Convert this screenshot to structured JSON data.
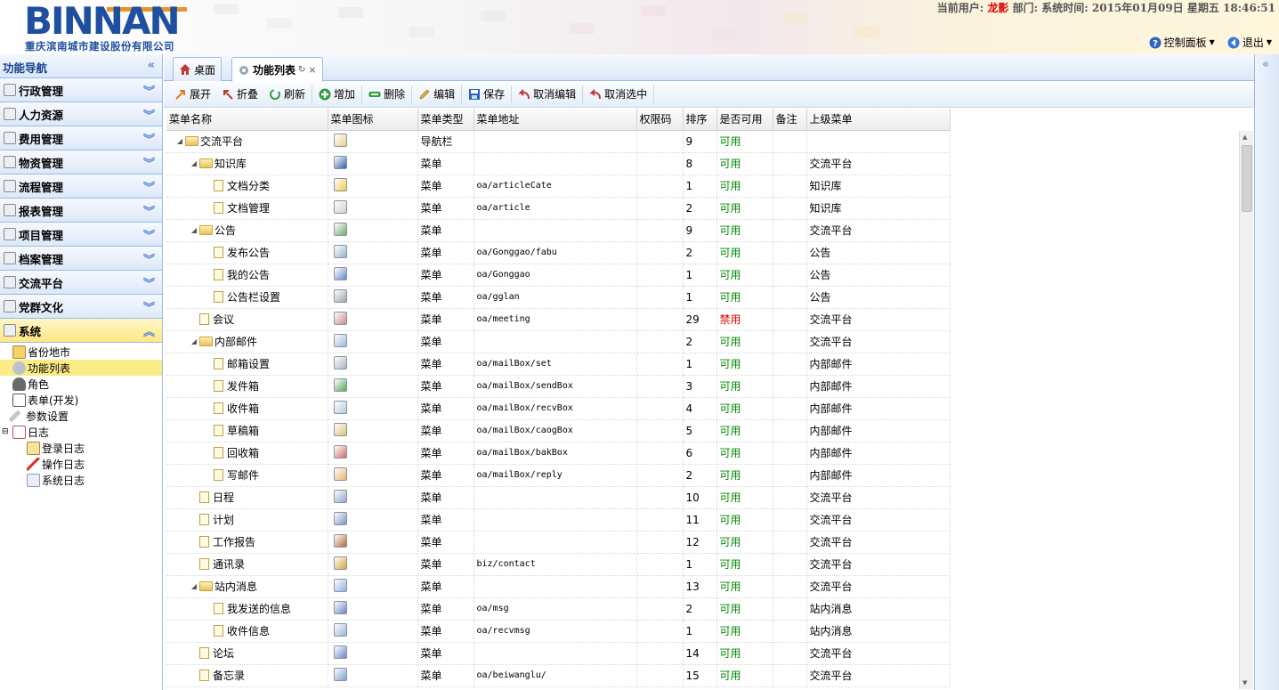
{
  "header": {
    "logo": "BINNAN",
    "company": "重庆滨南城市建设股份有限公司",
    "user_label": "当前用户:",
    "user_name": "龙影",
    "dept_label": "部门:",
    "time_label": "系统时间:",
    "time_value": "2015年01月09日 星期五 18:46:51",
    "control_panel": "控制面板",
    "logout": "退出"
  },
  "nav": {
    "title": "功能导航",
    "sections": [
      {
        "label": "行政管理"
      },
      {
        "label": "人力资源"
      },
      {
        "label": "费用管理"
      },
      {
        "label": "物资管理"
      },
      {
        "label": "流程管理"
      },
      {
        "label": "报表管理"
      },
      {
        "label": "项目管理"
      },
      {
        "label": "档案管理"
      },
      {
        "label": "交流平台"
      },
      {
        "label": "党群文化"
      },
      {
        "label": "系统"
      }
    ],
    "tree": [
      {
        "label": "省份地市"
      },
      {
        "label": "功能列表"
      },
      {
        "label": "角色"
      },
      {
        "label": "表单(开发)"
      },
      {
        "label": "参数设置"
      },
      {
        "label": "日志"
      },
      {
        "label": "登录日志"
      },
      {
        "label": "操作日志"
      },
      {
        "label": "系统日志"
      }
    ]
  },
  "tabs": [
    {
      "label": "桌面"
    },
    {
      "label": "功能列表"
    }
  ],
  "toolbar": {
    "expand": "展开",
    "collapse": "折叠",
    "refresh": "刷新",
    "add": "增加",
    "delete": "删除",
    "edit": "编辑",
    "save": "保存",
    "cancel_edit": "取消编辑",
    "cancel_select": "取消选中"
  },
  "columns": [
    "菜单名称",
    "菜单图标",
    "菜单类型",
    "菜单地址",
    "权限码",
    "排序",
    "是否可用",
    "备注",
    "上级菜单"
  ],
  "rows": [
    {
      "name": "交流平台",
      "type": "导航栏",
      "url": "",
      "code": "",
      "order": "9",
      "status": "可用",
      "note": "",
      "parent": ""
    },
    {
      "name": "知识库",
      "type": "菜单",
      "url": "",
      "code": "",
      "order": "8",
      "status": "可用",
      "note": "",
      "parent": "交流平台"
    },
    {
      "name": "文档分类",
      "type": "菜单",
      "url": "oa/articleCate",
      "code": "",
      "order": "1",
      "status": "可用",
      "note": "",
      "parent": "知识库"
    },
    {
      "name": "文档管理",
      "type": "菜单",
      "url": "oa/article",
      "code": "",
      "order": "2",
      "status": "可用",
      "note": "",
      "parent": "知识库"
    },
    {
      "name": "公告",
      "type": "菜单",
      "url": "",
      "code": "",
      "order": "9",
      "status": "可用",
      "note": "",
      "parent": "交流平台"
    },
    {
      "name": "发布公告",
      "type": "菜单",
      "url": "oa/Gonggao/fabu",
      "code": "",
      "order": "2",
      "status": "可用",
      "note": "",
      "parent": "公告"
    },
    {
      "name": "我的公告",
      "type": "菜单",
      "url": "oa/Gonggao",
      "code": "",
      "order": "1",
      "status": "可用",
      "note": "",
      "parent": "公告"
    },
    {
      "name": "公告栏设置",
      "type": "菜单",
      "url": "oa/gglan",
      "code": "",
      "order": "1",
      "status": "可用",
      "note": "",
      "parent": "公告"
    },
    {
      "name": "会议",
      "type": "菜单",
      "url": "oa/meeting",
      "code": "",
      "order": "29",
      "status": "禁用",
      "note": "",
      "parent": "交流平台"
    },
    {
      "name": "内部邮件",
      "type": "菜单",
      "url": "",
      "code": "",
      "order": "2",
      "status": "可用",
      "note": "",
      "parent": "交流平台"
    },
    {
      "name": "邮箱设置",
      "type": "菜单",
      "url": "oa/mailBox/set",
      "code": "",
      "order": "1",
      "status": "可用",
      "note": "",
      "parent": "内部邮件"
    },
    {
      "name": "发件箱",
      "type": "菜单",
      "url": "oa/mailBox/sendBox",
      "code": "",
      "order": "3",
      "status": "可用",
      "note": "",
      "parent": "内部邮件"
    },
    {
      "name": "收件箱",
      "type": "菜单",
      "url": "oa/mailBox/recvBox",
      "code": "",
      "order": "4",
      "status": "可用",
      "note": "",
      "parent": "内部邮件"
    },
    {
      "name": "草稿箱",
      "type": "菜单",
      "url": "oa/mailBox/caogBox",
      "code": "",
      "order": "5",
      "status": "可用",
      "note": "",
      "parent": "内部邮件"
    },
    {
      "name": "回收箱",
      "type": "菜单",
      "url": "oa/mailBox/bakBox",
      "code": "",
      "order": "6",
      "status": "可用",
      "note": "",
      "parent": "内部邮件"
    },
    {
      "name": "写邮件",
      "type": "菜单",
      "url": "oa/mailBox/reply",
      "code": "",
      "order": "2",
      "status": "可用",
      "note": "",
      "parent": "内部邮件"
    },
    {
      "name": "日程",
      "type": "菜单",
      "url": "",
      "code": "",
      "order": "10",
      "status": "可用",
      "note": "",
      "parent": "交流平台"
    },
    {
      "name": "计划",
      "type": "菜单",
      "url": "",
      "code": "",
      "order": "11",
      "status": "可用",
      "note": "",
      "parent": "交流平台"
    },
    {
      "name": "工作报告",
      "type": "菜单",
      "url": "",
      "code": "",
      "order": "12",
      "status": "可用",
      "note": "",
      "parent": "交流平台"
    },
    {
      "name": "通讯录",
      "type": "菜单",
      "url": "biz/contact",
      "code": "",
      "order": "1",
      "status": "可用",
      "note": "",
      "parent": "交流平台"
    },
    {
      "name": "站内消息",
      "type": "菜单",
      "url": "",
      "code": "",
      "order": "13",
      "status": "可用",
      "note": "",
      "parent": "交流平台"
    },
    {
      "name": "我发送的信息",
      "type": "菜单",
      "url": "oa/msg",
      "code": "",
      "order": "2",
      "status": "可用",
      "note": "",
      "parent": "站内消息"
    },
    {
      "name": "收件信息",
      "type": "菜单",
      "url": "oa/recvmsg",
      "code": "",
      "order": "1",
      "status": "可用",
      "note": "",
      "parent": "站内消息"
    },
    {
      "name": "论坛",
      "type": "菜单",
      "url": "",
      "code": "",
      "order": "14",
      "status": "可用",
      "note": "",
      "parent": "交流平台"
    },
    {
      "name": "备忘录",
      "type": "菜单",
      "url": "oa/beiwanglu/",
      "code": "",
      "order": "15",
      "status": "可用",
      "note": "",
      "parent": "交流平台"
    }
  ]
}
